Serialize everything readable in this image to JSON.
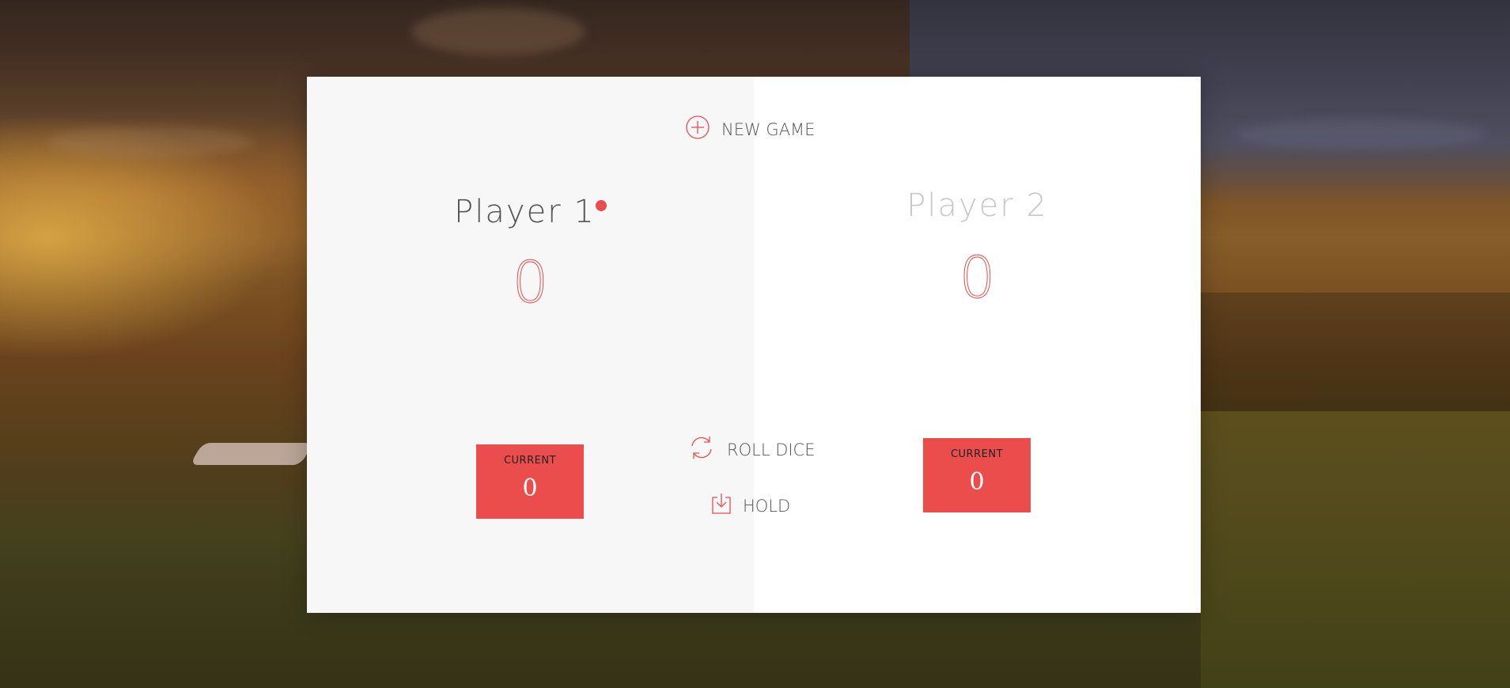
{
  "buttons": {
    "new_game": "NEW GAME",
    "roll_dice": "ROLL DICE",
    "hold": "HOLD"
  },
  "players": [
    {
      "name": "Player 1",
      "score": "0",
      "current_label": "CURRENT",
      "current_score": "0",
      "active": true
    },
    {
      "name": "Player 2",
      "score": "0",
      "current_label": "CURRENT",
      "current_score": "0",
      "active": false
    }
  ],
  "colors": {
    "accent": "#eb4d4d",
    "panel_active": "#f7f7f7",
    "panel_inactive": "#ffffff",
    "text": "#555555"
  },
  "icons": {
    "new_game": "plus-circle-icon",
    "roll_dice": "refresh-icon",
    "hold": "download-icon",
    "active_player": "active-dot-icon"
  }
}
